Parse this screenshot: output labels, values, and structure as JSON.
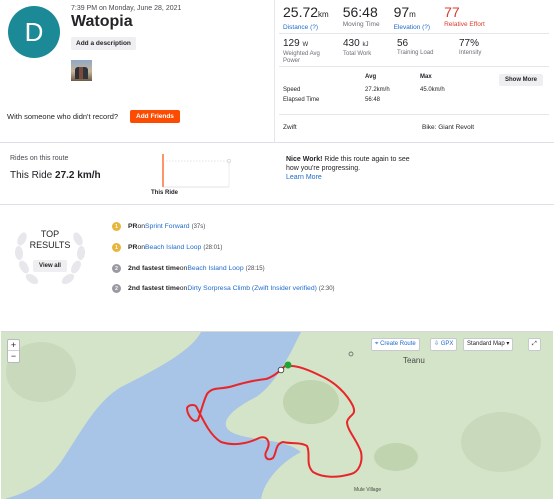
{
  "activity": {
    "avatar_letter": "D",
    "date": "7:39 PM on Monday, June 28, 2021",
    "title": "Watopia",
    "add_description": "Add a description",
    "with_someone": "With someone who didn't record?",
    "add_friends": "Add Friends"
  },
  "stats": {
    "distance": {
      "value": "25.72",
      "unit": "km",
      "label": "Distance",
      "help": "(?)"
    },
    "moving_time": {
      "value": "56:48",
      "label": "Moving Time"
    },
    "elevation": {
      "value": "97",
      "unit": "m",
      "label": "Elevation",
      "help": "(?)"
    },
    "relative_effort": {
      "value": "77",
      "label": "Relative Effort"
    },
    "power": {
      "value": "129",
      "unit": "W",
      "label": "Weighted Avg Power"
    },
    "work": {
      "value": "430",
      "unit": "kJ",
      "label": "Total Work"
    },
    "training_load": {
      "value": "56",
      "label": "Training Load"
    },
    "intensity": {
      "value": "77%",
      "label": "Intensity"
    }
  },
  "table": {
    "col_avg": "Avg",
    "col_max": "Max",
    "speed_label": "Speed",
    "speed_avg": "27.2km/h",
    "speed_max": "45.0km/h",
    "elapsed_label": "Elapsed Time",
    "elapsed_avg": "56:48",
    "show_more": "Show More",
    "device": "Zwift",
    "bike": "Bike: Giant Revolt"
  },
  "rides": {
    "label": "Rides on this route",
    "this_ride_prefix": "This Ride",
    "this_ride_value": "27.2 km/h",
    "graph_label": "This Ride",
    "nice_bold": "Nice Work!",
    "nice_text": " Ride this route again to see how you're progressing.",
    "learn_more": "Learn More"
  },
  "results": {
    "top_line1": "TOP",
    "top_line2": "RESULTS",
    "view_all": "View all",
    "items": [
      {
        "medal": "gold",
        "prefix": "PR",
        "on": " on ",
        "segment": "Sprint Forward",
        "time": "(37s)"
      },
      {
        "medal": "gold",
        "prefix": "PR",
        "on": " on ",
        "segment": "Beach Island Loop",
        "time": "(28:01)"
      },
      {
        "medal": "silver",
        "prefix": "2nd fastest time",
        "on": " on ",
        "segment": "Beach Island Loop",
        "time": "(28:15)"
      },
      {
        "medal": "silver",
        "prefix": "2nd fastest time",
        "on": " on ",
        "segment": "Dirty Sorpresa Climb (Zwift Insider verified)",
        "time": "(2:30)"
      }
    ]
  },
  "map": {
    "zoom_in": "+",
    "zoom_out": "−",
    "create_route": "Create Route",
    "gpx": "GPX",
    "map_type": "Standard Map",
    "place_teanu": "Teanu",
    "place_mule": "Mule Village",
    "colors": {
      "water": "#a8c4e6",
      "land": "#d4e4c8",
      "route": "#e8262a"
    }
  }
}
